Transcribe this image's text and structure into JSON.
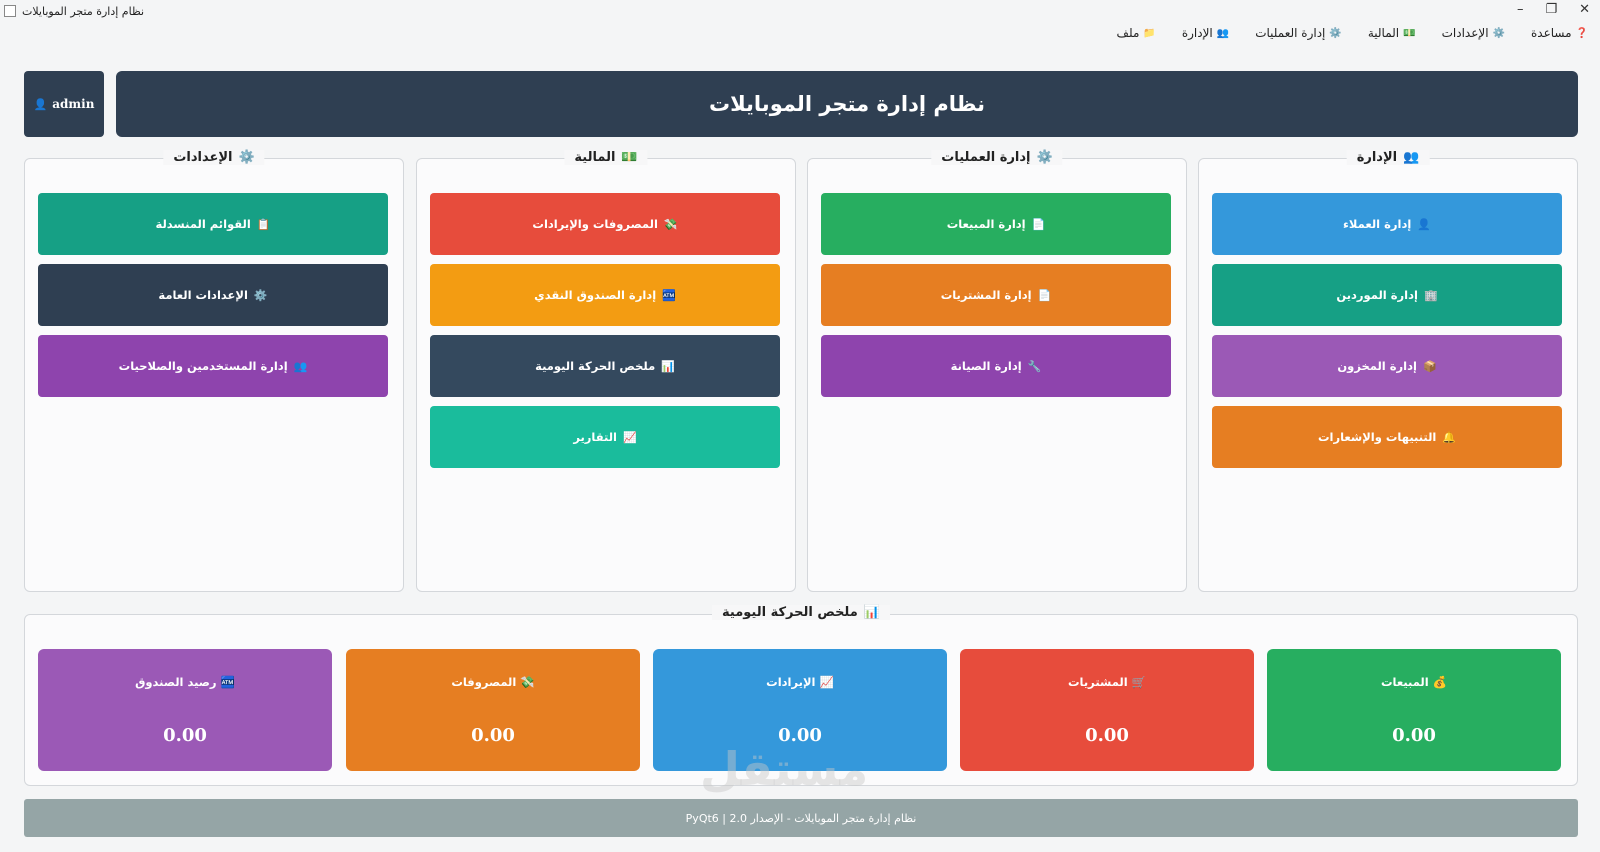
{
  "window": {
    "title": "نظام إدارة متجر الموبايلات",
    "minimize": "–",
    "maximize": "❐",
    "close": "✕"
  },
  "menu": [
    {
      "label": "ملف",
      "icon": "📁"
    },
    {
      "label": "الإدارة",
      "icon": "👥"
    },
    {
      "label": "إدارة العمليات",
      "icon": "⚙️"
    },
    {
      "label": "المالية",
      "icon": "💵"
    },
    {
      "label": "الإعدادات",
      "icon": "⚙️"
    },
    {
      "label": "مساعدة",
      "icon": "❓"
    }
  ],
  "header": {
    "title": "نظام إدارة متجر الموبايلات",
    "user": "admin",
    "user_icon": "👤"
  },
  "groups": {
    "admin": {
      "title": "الإدارة",
      "icon": "👥",
      "buttons": [
        {
          "label": "إدارة العملاء",
          "icon": "👤",
          "color": "#3498db"
        },
        {
          "label": "إدارة الموردين",
          "icon": "🏢",
          "color": "#16a085"
        },
        {
          "label": "إدارة المخزون",
          "icon": "📦",
          "color": "#9b59b6"
        },
        {
          "label": "التنبيهات والإشعارات",
          "icon": "🔔",
          "color": "#e67e22"
        }
      ]
    },
    "operations": {
      "title": "إدارة العمليات",
      "icon": "⚙️",
      "buttons": [
        {
          "label": "إدارة المبيعات",
          "icon": "📄",
          "color": "#27ae60"
        },
        {
          "label": "إدارة المشتريات",
          "icon": "📄",
          "color": "#e67e22"
        },
        {
          "label": "إدارة الصيانة",
          "icon": "🔧",
          "color": "#8e44ad"
        }
      ]
    },
    "finance": {
      "title": "المالية",
      "icon": "💵",
      "buttons": [
        {
          "label": "المصروفات والإيرادات",
          "icon": "💸",
          "color": "#e74c3c"
        },
        {
          "label": "إدارة الصندوق النقدي",
          "icon": "🏧",
          "color": "#f39c12"
        },
        {
          "label": "ملخص الحركة اليومية",
          "icon": "📊",
          "color": "#34495e"
        },
        {
          "label": "التقارير",
          "icon": "📈",
          "color": "#1abc9c"
        }
      ]
    },
    "settings": {
      "title": "الإعدادات",
      "icon": "⚙️",
      "buttons": [
        {
          "label": "القوائم المنسدلة",
          "icon": "📋",
          "color": "#16a085"
        },
        {
          "label": "الإعدادات العامة",
          "icon": "⚙️",
          "color": "#2f3f52"
        },
        {
          "label": "إدارة المستخدمين والصلاحيات",
          "icon": "👥",
          "color": "#8e44ad"
        }
      ]
    }
  },
  "summary": {
    "title": "ملخص الحركة اليومية",
    "icon": "📊",
    "cards": [
      {
        "label": "المبيعات",
        "icon": "💰",
        "value": "0.00",
        "color": "#27ae60"
      },
      {
        "label": "المشتريات",
        "icon": "🛒",
        "value": "0.00",
        "color": "#e74c3c"
      },
      {
        "label": "الإيرادات",
        "icon": "📈",
        "value": "0.00",
        "color": "#3498db"
      },
      {
        "label": "المصروفات",
        "icon": "💸",
        "value": "0.00",
        "color": "#e67e22"
      },
      {
        "label": "رصيد الصندوق",
        "icon": "🏧",
        "value": "0.00",
        "color": "#9b59b6"
      }
    ]
  },
  "footer": {
    "text": "نظام إدارة متجر الموبايلات - الإصدار 2.0 | PyQt6"
  },
  "watermark": "مستقل"
}
